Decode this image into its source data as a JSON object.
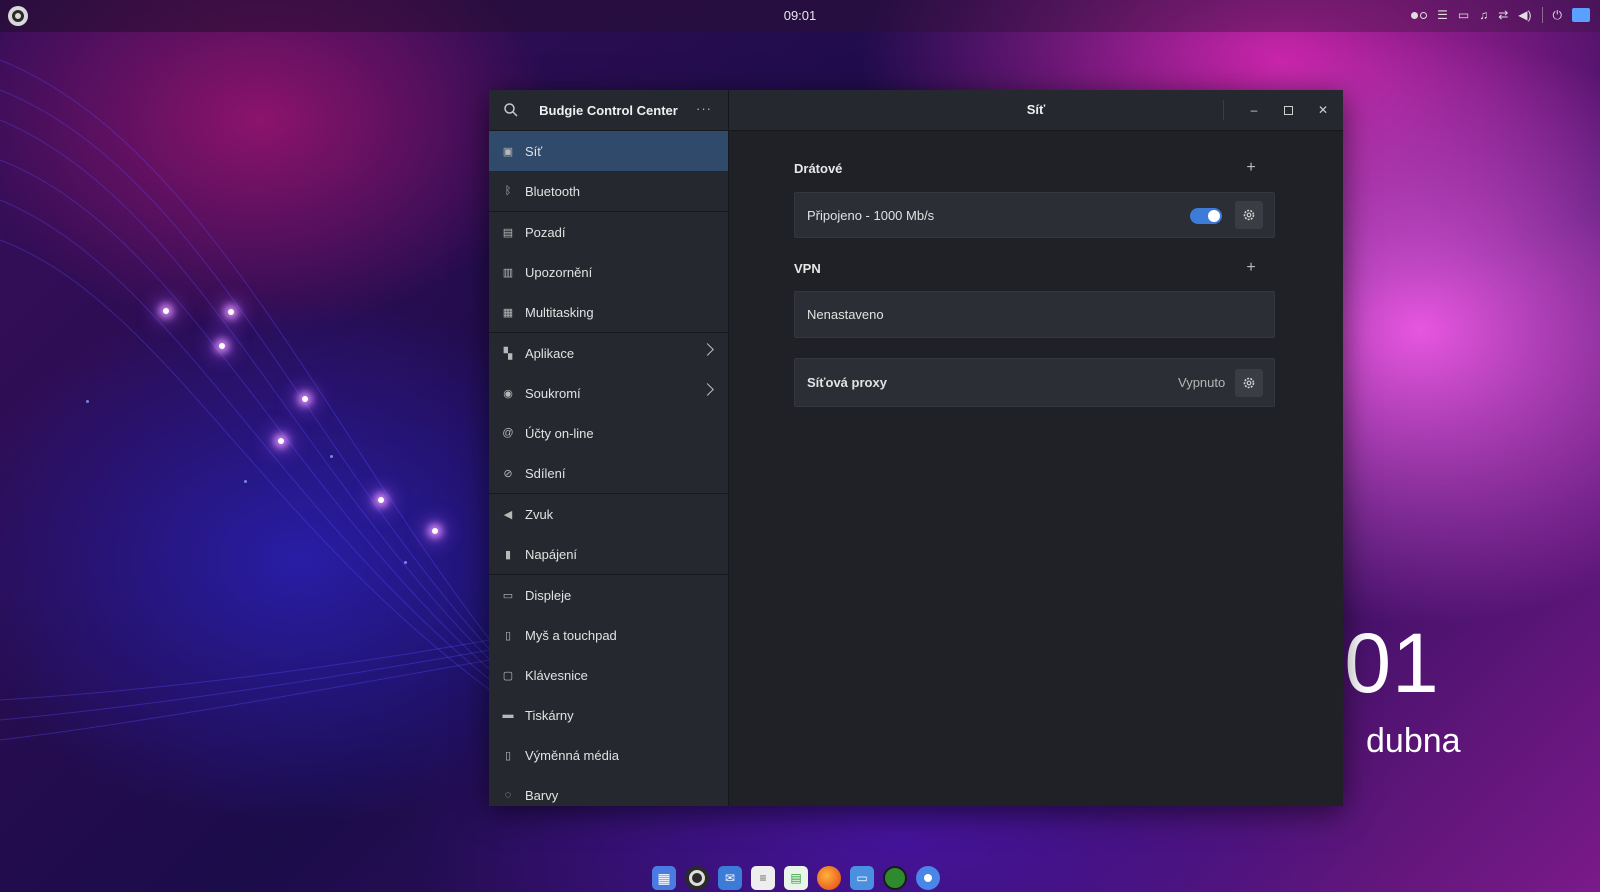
{
  "top_panel": {
    "clock": "09:01"
  },
  "desktop": {
    "time": ":01",
    "date": "dubna"
  },
  "window": {
    "sidebar_title": "Budgie Control Center",
    "more_label": "···",
    "content_title": "Síť",
    "sidebar_items": [
      {
        "label": "Síť",
        "icon": "network-icon",
        "active": true
      },
      {
        "label": "Bluetooth",
        "icon": "bluetooth-icon"
      },
      {
        "label": "Pozadí",
        "icon": "background-icon"
      },
      {
        "label": "Upozornění",
        "icon": "notifications-icon"
      },
      {
        "label": "Multitasking",
        "icon": "multitasking-icon"
      },
      {
        "label": "Aplikace",
        "icon": "applications-icon",
        "chevron": true
      },
      {
        "label": "Soukromí",
        "icon": "privacy-icon",
        "chevron": true
      },
      {
        "label": "Účty on-line",
        "icon": "online-accounts-icon"
      },
      {
        "label": "Sdílení",
        "icon": "sharing-icon"
      },
      {
        "label": "Zvuk",
        "icon": "sound-icon"
      },
      {
        "label": "Napájení",
        "icon": "power-icon"
      },
      {
        "label": "Displeje",
        "icon": "displays-icon"
      },
      {
        "label": "Myš a touchpad",
        "icon": "mouse-icon"
      },
      {
        "label": "Klávesnice",
        "icon": "keyboard-icon"
      },
      {
        "label": "Tiskárny",
        "icon": "printers-icon"
      },
      {
        "label": "Výměnná média",
        "icon": "removable-media-icon"
      },
      {
        "label": "Barvy",
        "icon": "color-icon"
      }
    ],
    "wired": {
      "title": "Drátové",
      "status": "Připojeno - 1000 Mb/s",
      "enabled": true
    },
    "vpn": {
      "title": "VPN",
      "status": "Nenastaveno"
    },
    "proxy": {
      "title": "Síťová proxy",
      "status": "Vypnuto"
    }
  },
  "colors": {
    "accent": "#3d7bd9",
    "active_row": "#2f4a6a",
    "window_bg": "#1f2126",
    "sidebar_bg": "#25282e"
  },
  "dock": [
    "apps-grid-icon",
    "budgie-icon",
    "mail-icon",
    "text-editor-icon",
    "spreadsheet-icon",
    "firefox-icon",
    "files-icon",
    "green-app-icon",
    "blue-app-icon"
  ]
}
